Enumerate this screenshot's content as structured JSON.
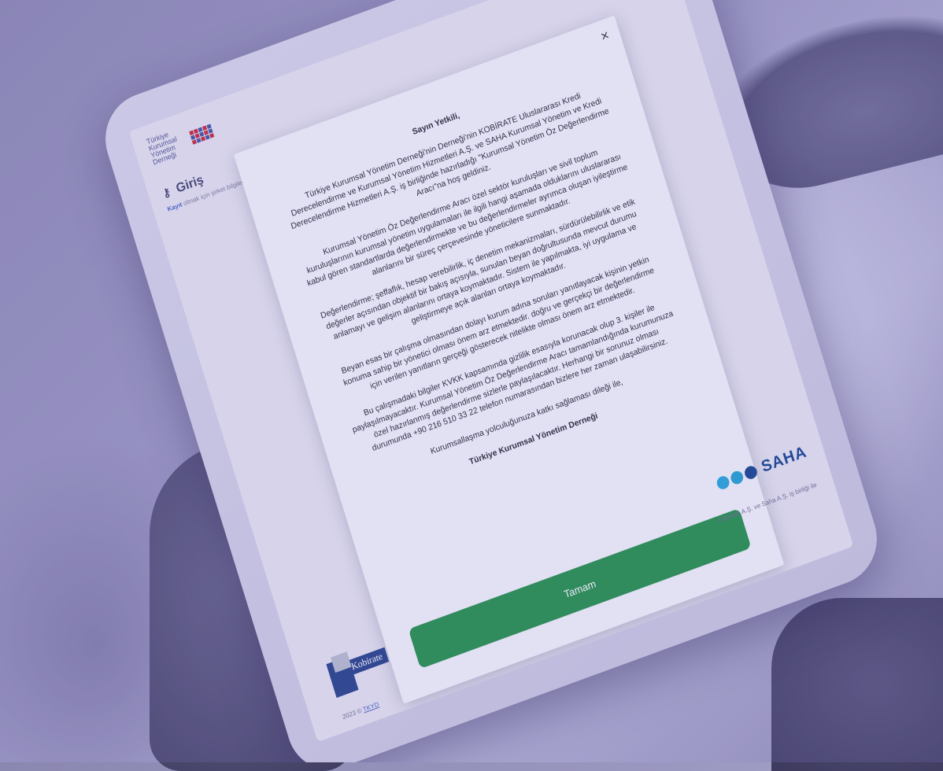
{
  "app": {
    "logo_text": "Türkiye Kurumsal Yönetim Derneği",
    "page_title": "Giriş",
    "register_link": "Kayıt",
    "register_text": "olmak için şirket bilgilerinizi girerek şifre oluşturabilirsiniz."
  },
  "modal": {
    "close_icon": "×",
    "greeting": "Sayın Yetkili,",
    "paragraphs": [
      "Türkiye Kurumsal Yönetim Derneği'nin Derneği'nin KOBİRATE Uluslararası Kredi Derecelendirme ve Kurumsal Yönetim Hizmetleri A.Ş. ve SAHA Kurumsal Yönetim ve Kredi Derecelendirme Hizmetleri A.Ş. iş birliğinde hazırladığı \"Kurumsal Yönetim Öz Değerlendirme Aracı\"na hoş geldiniz.",
      "Kurumsal Yönetim Öz Değerlendirme Aracı özel sektör kuruluşları ve sivil toplum kuruluşlarının kurumsal yönetim uygulamaları ile ilgili hangi aşamada olduklarını uluslararası kabul gören standartlarda değerlendirmekte ve bu değerlendirmeler ayrımca oluşan iyileştirme alanlarını bir süreç çerçevesinde yöneticilere sunmaktadır.",
      "Değerlendirme; şeffaflık, hesap verebilirlik, iç denetim mekanizmaları, sürdürülebilirlik ve etik değerler açısından objektif bir bakış açısıyla, sunulan beyan doğrultusunda mevcut durumu anlamayı ve gelişim alanlarını ortaya koymaktadır. Sistem ile yapılmakta, iyi uygulama ve geliştirmeye açık alanları ortaya koymaktadır.",
      "Beyan esas bir çalışma olmasından dolayı kurum adına soruları yanıtlayacak kişinin yetkin konuma sahip bir yönetici olması önem arz etmektedir. doğru ve gerçekçi bir değerlendirme için verilen yanıtların gerçeği gösterecek nitelikte olması önem arz etmektedir.",
      "Bu çalışmadaki bilgiler KVKK kapsamında gizlilik esasıyla korunacak olup 3. kişiler ile paylaşılmayacaktır. Kurumsal Yönetim Öz Değerlendirme Aracı tamamlandığında kurumunuza özel hazırlanmış değerlendirme sizlerle paylaşılacaktır. Herhangi bir sorunuz olması durumunda +90 216 510 33 22 telefon numarasından bizlere her zaman ulaşabilirsiniz.",
      "Kurumsallaşma yolculuğunuza katkı sağlaması dileği ile,"
    ],
    "signature": "Türkiye Kurumsal Yönetim Derneği",
    "button_label": "Tamam"
  },
  "footer": {
    "saha_logo_text": "SAHA",
    "collab_text": "Kobirate A.Ş. ve Saha A.Ş. iş birliği ile",
    "kobirate_logo_text": "Kobirate",
    "copyright": "2023 ©",
    "copyright_link": "TKYD"
  }
}
